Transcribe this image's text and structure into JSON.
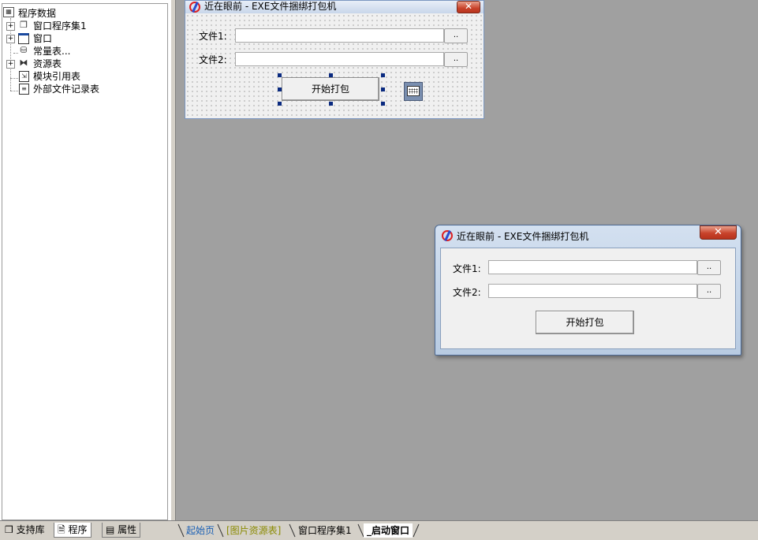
{
  "tree": {
    "root_label": "程序数据",
    "items": [
      {
        "label": "窗口程序集1",
        "expandable": true,
        "icon": "program-set-icon"
      },
      {
        "label": "窗口",
        "expandable": true,
        "icon": "window-icon"
      },
      {
        "label": "常量表...",
        "expandable": false,
        "icon": "constant-table-icon"
      },
      {
        "label": "资源表",
        "expandable": true,
        "icon": "resource-table-icon"
      },
      {
        "label": "模块引用表",
        "expandable": false,
        "icon": "module-reference-icon"
      },
      {
        "label": "外部文件记录表",
        "expandable": false,
        "icon": "external-file-icon"
      }
    ]
  },
  "left_tabs": [
    {
      "label": "支持库",
      "icon": "library-icon",
      "active": false
    },
    {
      "label": "程序",
      "icon": "program-icon",
      "active": true
    },
    {
      "label": "属性",
      "icon": "property-icon",
      "active": false
    }
  ],
  "design_form": {
    "title": "近在眼前 - EXE文件捆绑打包机",
    "close_glyph": "✕",
    "label_file1": "文件1:",
    "label_file2": "文件2:",
    "file1_value": "",
    "file2_value": "",
    "browse1_label": "..",
    "browse2_label": "..",
    "start_button_label": "开始打包"
  },
  "run_window": {
    "title": "近在眼前 - EXE文件捆绑打包机",
    "close_glyph": "✕",
    "label_file1": "文件1:",
    "label_file2": "文件2:",
    "file1_value": "",
    "file2_value": "",
    "browse1_label": "..",
    "browse2_label": "..",
    "start_button_label": "开始打包"
  },
  "doc_tabs": [
    {
      "label": "起始页",
      "color": "#1a5fb4",
      "active": false
    },
    {
      "label": "[图片资源表]",
      "color": "#8a8a00",
      "active": false
    },
    {
      "label": "窗口程序集1",
      "color": "#000000",
      "active": false
    },
    {
      "label": "_启动窗口",
      "color": "#000000",
      "active": true
    }
  ],
  "colors": {
    "design_area_bg": "#a0a0a0",
    "selection_handle": "#0a2a80"
  }
}
